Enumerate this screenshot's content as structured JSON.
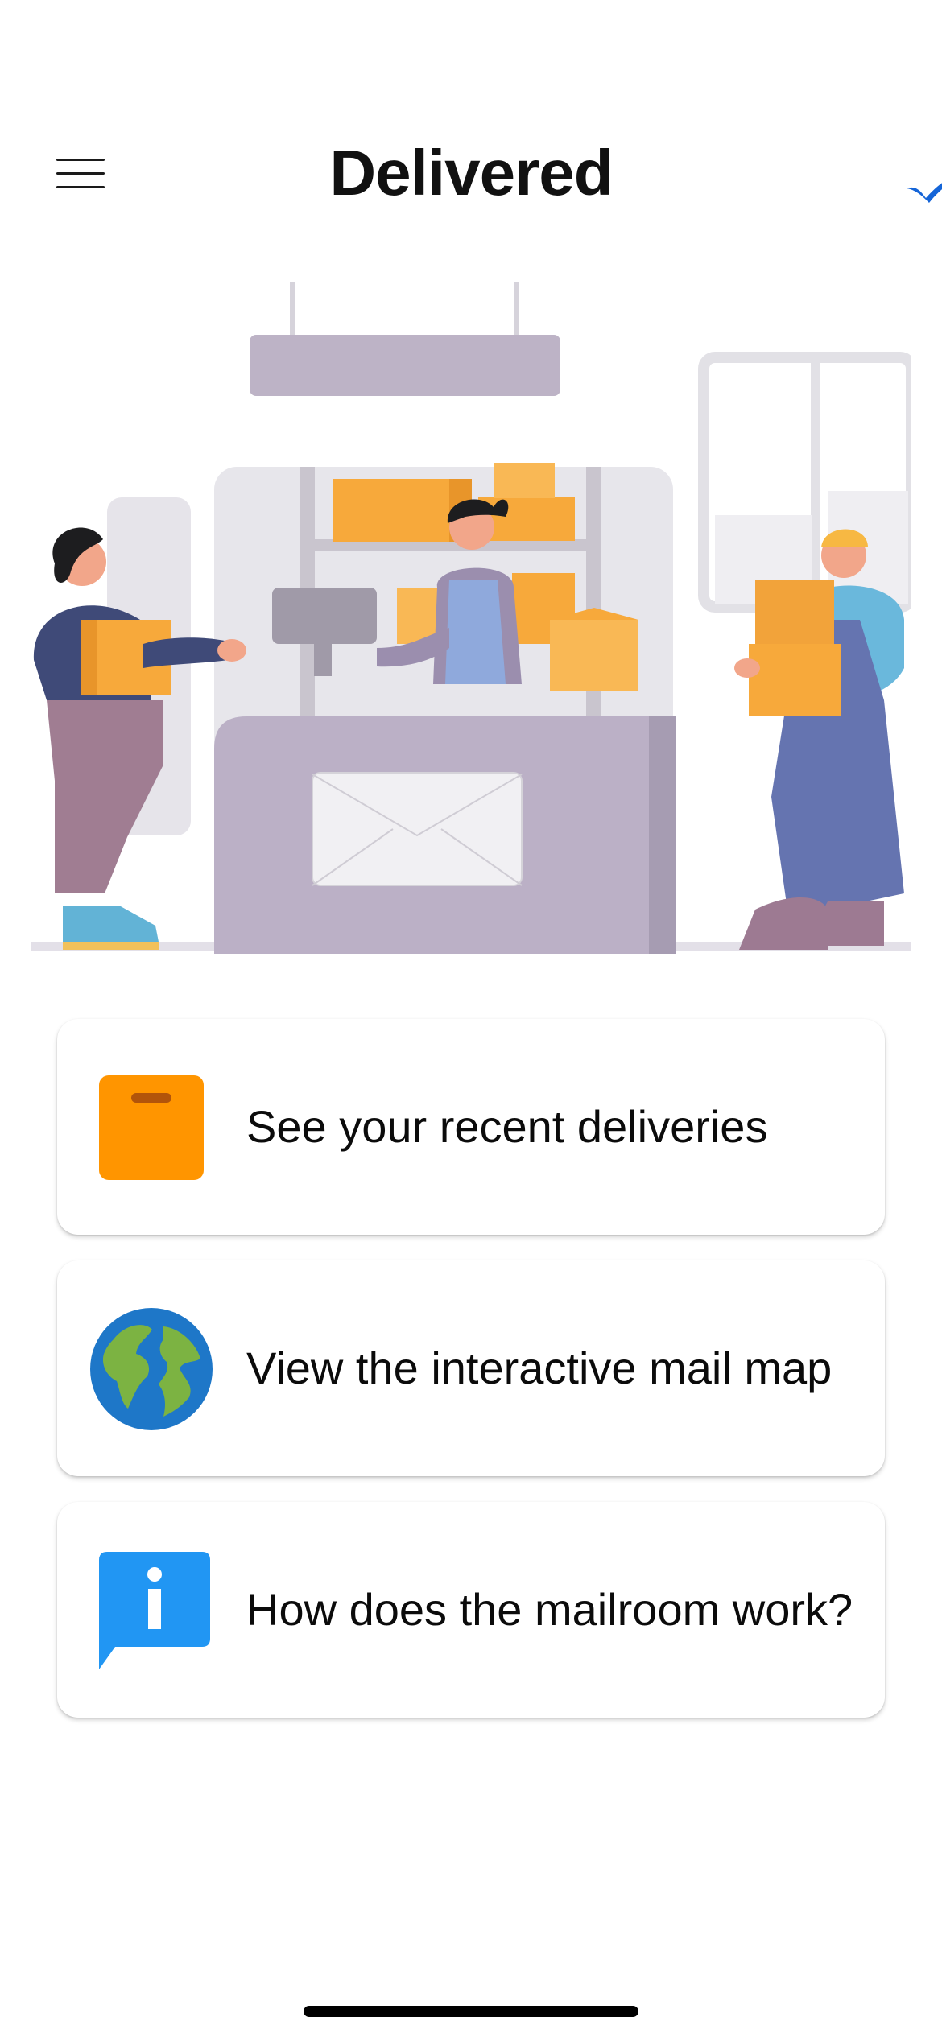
{
  "header": {
    "app_title": "Delivered",
    "menu_icon": "hamburger-menu-icon"
  },
  "hero": {
    "illustration": "mailroom-counter-illustration"
  },
  "menu_cards": [
    {
      "label": "See your recent deliveries",
      "icon": "package-icon",
      "icon_color": "#FF9500"
    },
    {
      "label": "View the interactive mail map",
      "icon": "globe-icon",
      "icon_color": "#1E77C8"
    },
    {
      "label": "How does the mailroom work?",
      "icon": "info-icon",
      "icon_color": "#2196F3"
    }
  ],
  "colors": {
    "background": "#FFFFFF",
    "logo_check": "#1565D8",
    "box_orange": "#F7A93B",
    "counter_purple": "#B8AEC1"
  }
}
